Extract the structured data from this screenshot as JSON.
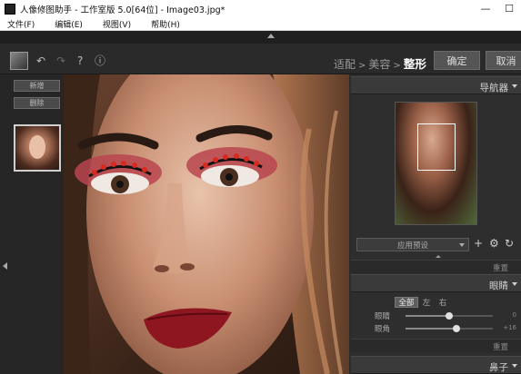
{
  "window": {
    "title": "人像修图助手 - 工作室版 5.0[64位] - Image03.jpg*",
    "minimize_glyph": "—",
    "maximize_glyph": "☐"
  },
  "menu": {
    "items": [
      {
        "label": "文件(F)"
      },
      {
        "label": "编辑(E)"
      },
      {
        "label": "视图(V)"
      },
      {
        "label": "帮助(H)"
      }
    ]
  },
  "toolbar": {
    "undo_glyph": "↶",
    "redo_glyph": "↷",
    "help_glyph": "?",
    "info_glyph": "ⓘ",
    "breadcrumb": {
      "step1": "适配",
      "sep": ">",
      "step2": "美容",
      "step3": "整形"
    },
    "confirm_label": "确定",
    "cancel_label": "取消"
  },
  "left_panel": {
    "add_label": "新增",
    "delete_label": "删除"
  },
  "right_panel": {
    "navigator_title": "导航器",
    "preset_placeholder": "应用预设",
    "add_glyph": "+",
    "settings_glyph": "⚙",
    "refresh_glyph": "↻",
    "reset_label": "重置",
    "eyes_title": "眼睛",
    "segments": [
      {
        "label": "全部",
        "active": true
      },
      {
        "label": "左",
        "active": false
      },
      {
        "label": "右",
        "active": false
      }
    ],
    "sliders": [
      {
        "label": "眼睛",
        "value": "0",
        "level": 0.5
      },
      {
        "label": "眼角",
        "value": "+16",
        "level": 0.58
      }
    ],
    "reset_label_2": "重置",
    "nose_title": "鼻子"
  }
}
